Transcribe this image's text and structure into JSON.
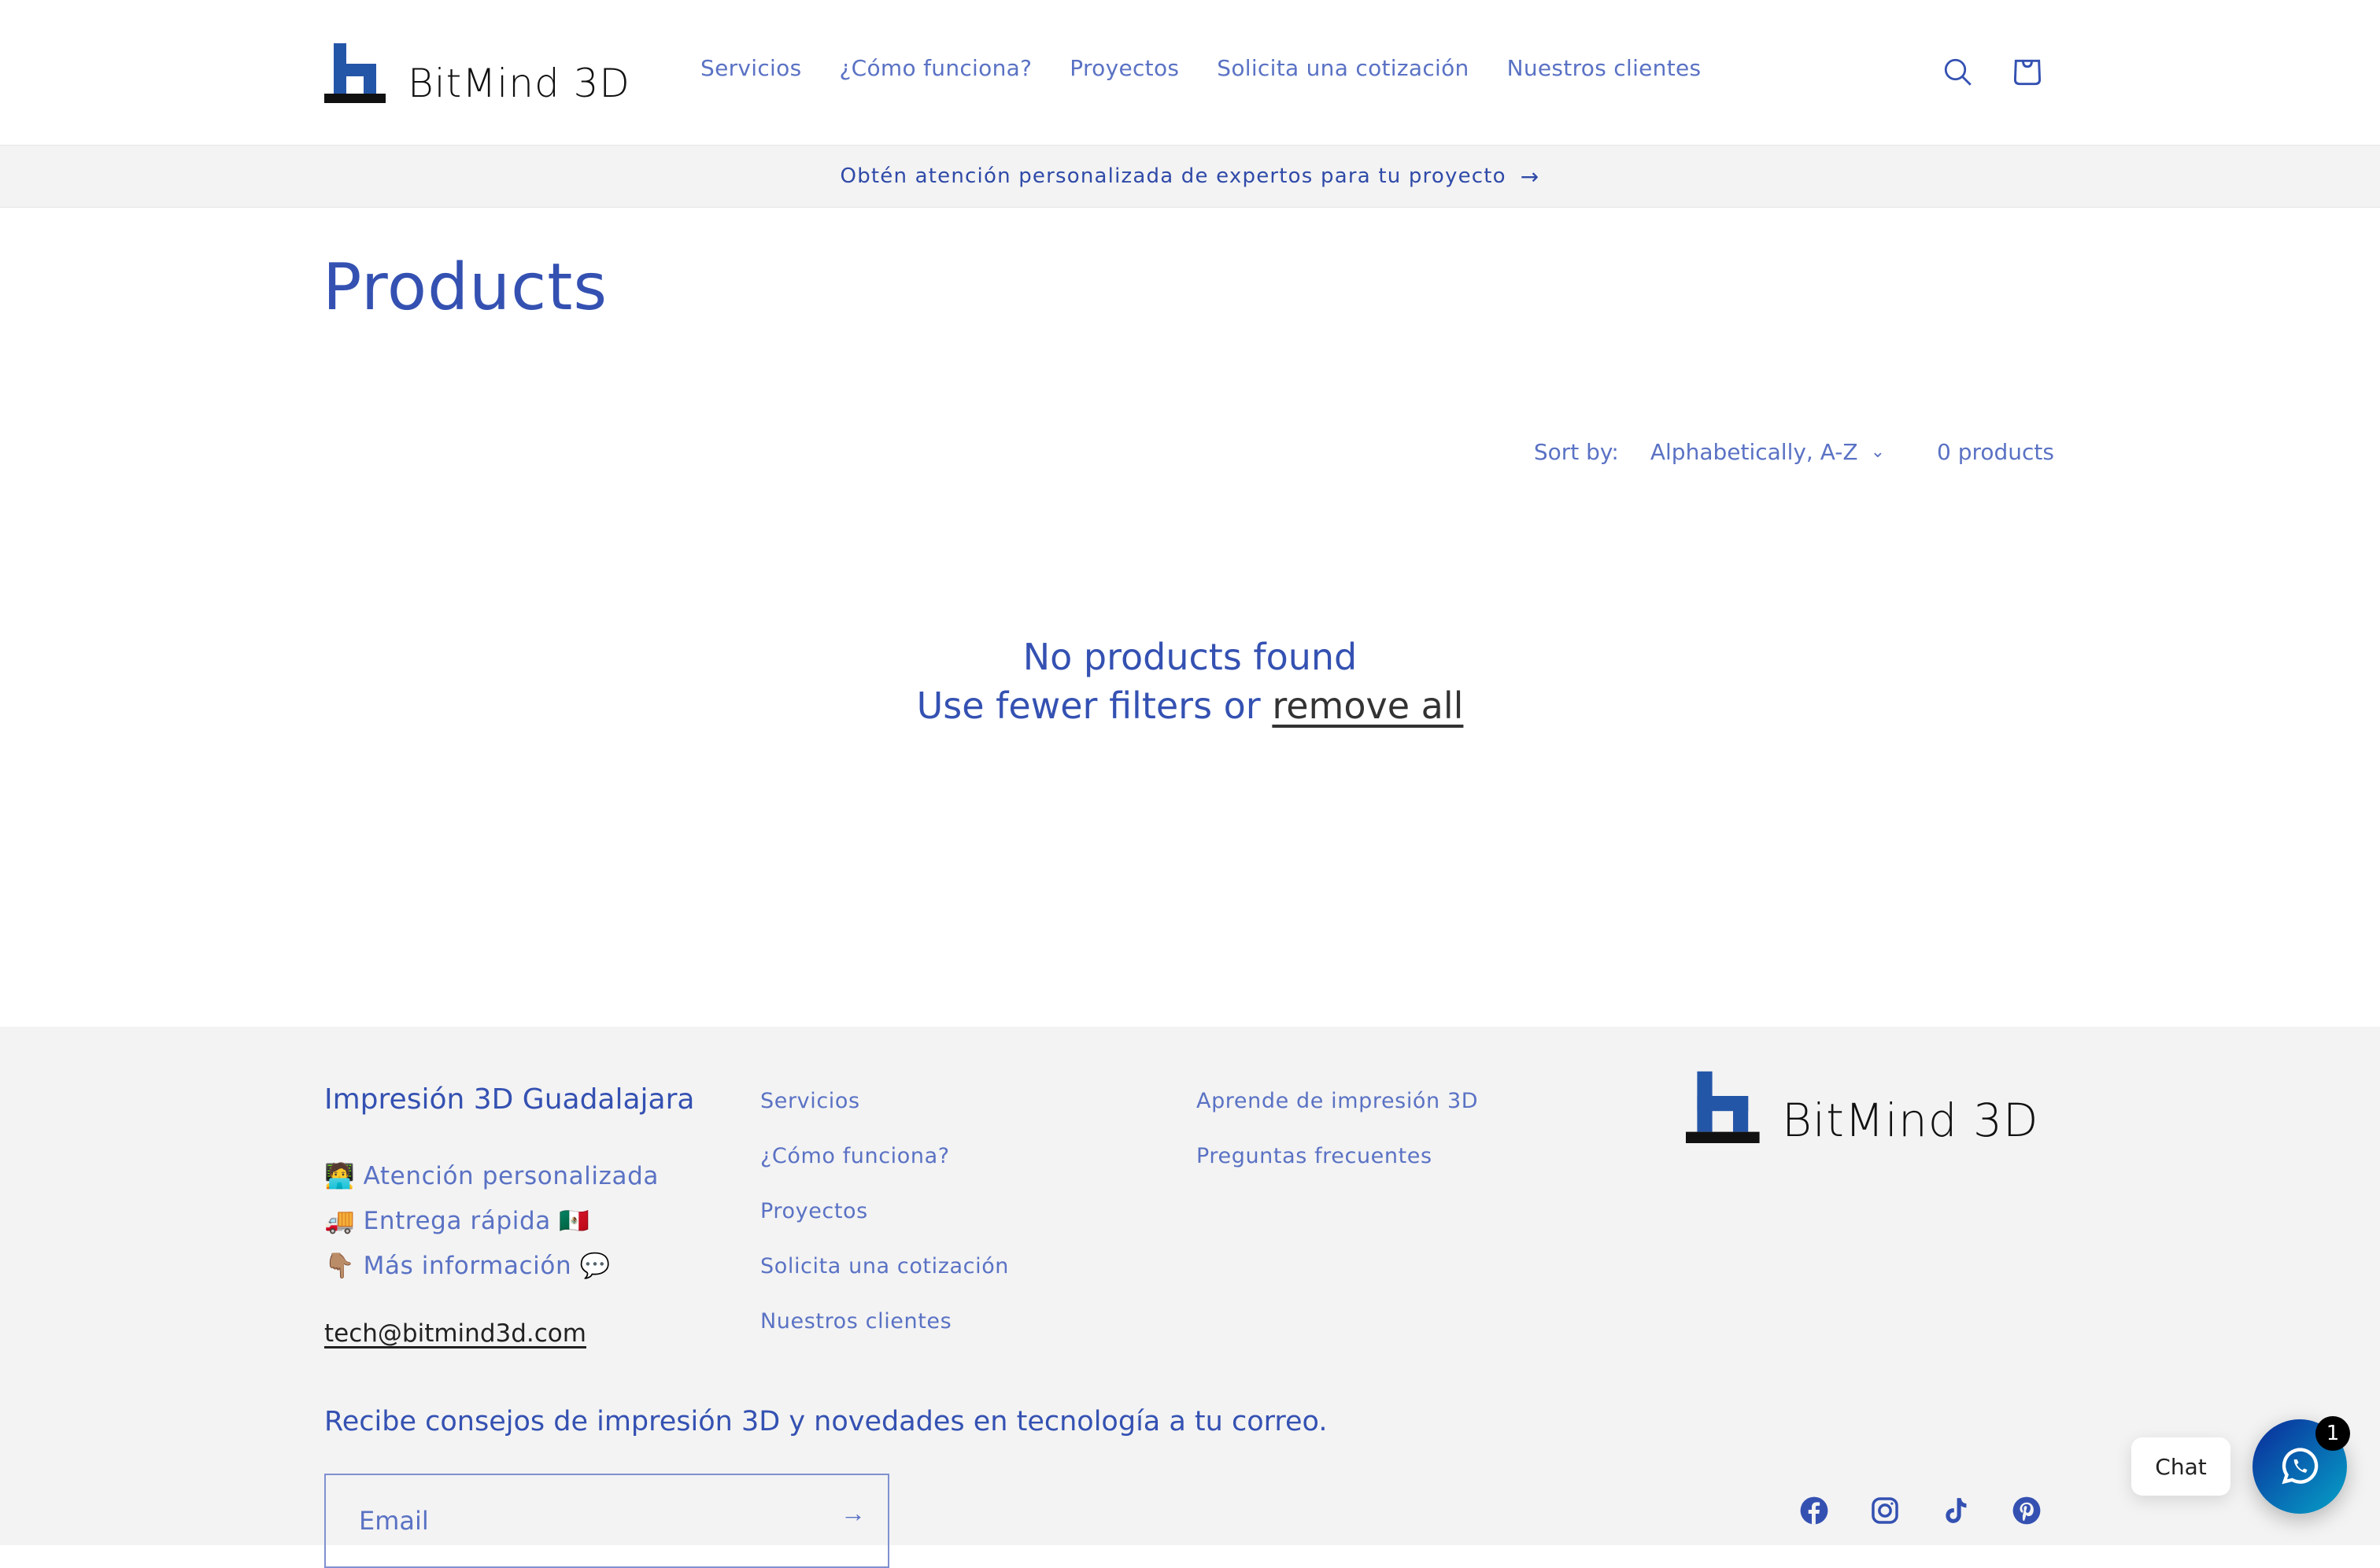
{
  "brand": {
    "name": "BitMind 3D",
    "accent": "#3451b2",
    "link_color": "#5a72c4",
    "logo_blue": "#2456a8"
  },
  "header": {
    "nav": [
      "Servicios",
      "¿Cómo funciona?",
      "Proyectos",
      "Solicita una cotización",
      "Nuestros clientes"
    ],
    "icons": {
      "search": "search-icon",
      "cart": "cart-icon"
    }
  },
  "announcement": {
    "text": "Obtén atención personalizada de expertos para tu proyecto",
    "arrow": "→"
  },
  "main": {
    "title": "Products",
    "sort_label": "Sort by:",
    "sort_value": "Alphabetically, A-Z",
    "product_count": "0 products",
    "empty_title": "No products found",
    "empty_hint": "Use fewer filters or",
    "empty_link": "remove all"
  },
  "footer": {
    "heading": "Impresión 3D Guadalajara",
    "features": [
      "🧑‍💻 Atención personalizada",
      "🚚 Entrega rápida 🇲🇽",
      "👇🏽 Más información 💬"
    ],
    "email": "tech@bitmind3d.com",
    "col1": [
      "Servicios",
      "¿Cómo funciona?",
      "Proyectos",
      "Solicita una cotización",
      "Nuestros clientes"
    ],
    "col2": [
      "Aprende de impresión 3D",
      "Preguntas frecuentes"
    ],
    "newsletter_heading": "Recibe consejos de impresión 3D y novedades en tecnología a tu correo.",
    "newsletter_placeholder": "Email",
    "newsletter_value": "",
    "social": [
      "facebook-icon",
      "instagram-icon",
      "tiktok-icon",
      "pinterest-icon"
    ]
  },
  "chat": {
    "label": "Chat",
    "badge": "1",
    "icon": "whatsapp-icon"
  }
}
